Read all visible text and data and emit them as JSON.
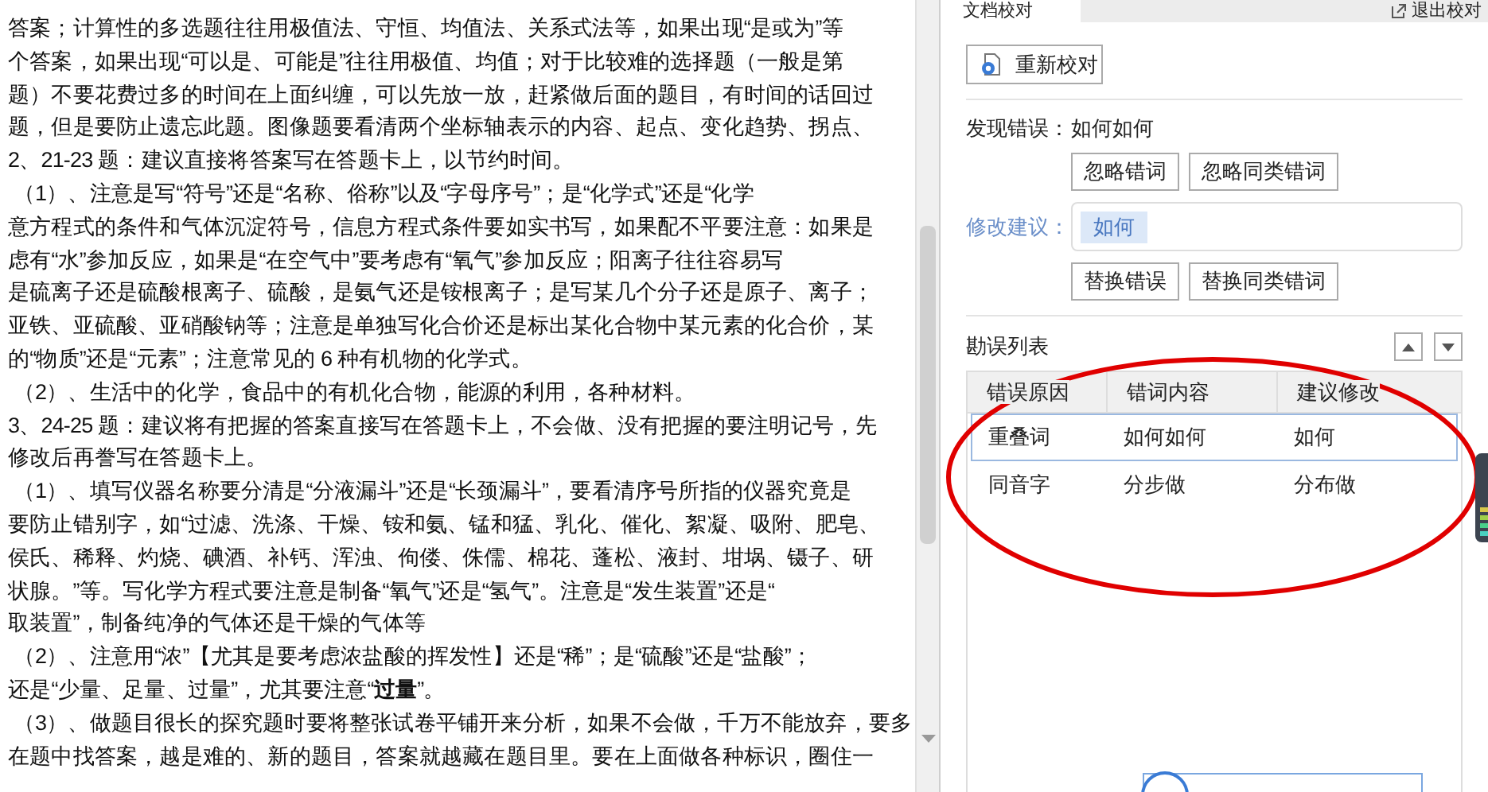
{
  "document": {
    "lines": [
      "答案；计算性的多选题往往用极值法、守恒、均值法、关系式法等，如果出现“是或为”等",
      "个答案，如果出现“可以是、可能是”往往用极值、均值；对于比较难的选择题（一般是第",
      "题）不要花费过多的时间在上面纠缠，可以先放一放，赶紧做后面的题目，有时间的话回过",
      "题，但是要防止遗忘此题。图像题要看清两个坐标轴表示的内容、起点、变化趋势、拐点、",
      "2、21-23 题：建议直接将答案写在答题卡上，以节约时间。",
      " （1）、注意是写“符号”还是“名称、俗称”以及“字母序号”；是“化学式”还是“化学",
      "意方程式的条件和气体沉淀符号，信息方程式条件要如实书写，如果配不平要注意：如果是",
      "虑有“水”参加反应，如果是“在空气中”要考虑有“氧气”参加反应；阳离子往往容易写",
      "是硫离子还是硫酸根离子、硫酸，是氨气还是铵根离子；是写某几个分子还是原子、离子；",
      "亚铁、亚硫酸、亚硝酸钠等；注意是单独写化合价还是标出某化合物中某元素的化合价，某",
      "的“物质”还是“元素”；注意常见的 6 种有机物的化学式。",
      " （2）、生活中的化学，食品中的有机化合物，能源的利用，各种材料。",
      "3、24-25 题：建议将有把握的答案直接写在答题卡上，不会做、没有把握的要注明记号，先",
      "修改后再誊写在答题卡上。",
      " （1）、填写仪器名称要分清是“分液漏斗”还是“长颈漏斗”，要看清序号所指的仪器究竟是",
      "要防止错别字，如“过滤、洗涤、干燥、铵和氨、锰和猛、乳化、催化、絮凝、吸附、肥皂、",
      "侯氏、稀释、灼烧、碘酒、补钙、浑浊、佝偻、侏儒、棉花、蓬松、液封、坩埚、镊子、研",
      "状腺。”等。写化学方程式要注意是制备“氧气”还是“氢气”。注意是“发生装置”还是“",
      "取装置”，制备纯净的气体还是干燥的气体等",
      " （2）、注意用“浓”【尤其是要考虑浓盐酸的挥发性】还是“稀”；是“硫酸”还是“盐酸”；",
      "还是“少量、足量、过量”，尤其要注意“**过量**”。",
      " （3）、做题目很长的探究题时要将整张试卷平铺开来分析，如果不会做，千万不能放弃，要多",
      "在题中找答案，越是难的、新的题目，答案就越藏在题目里。要在上面做各种标识，圈住一"
    ]
  },
  "panel": {
    "tab": "文档校对",
    "exit_button": "退出校对",
    "recheck_button": "重新校对",
    "found_label": "发现错误：",
    "found_value": "如何如何",
    "ignore_buttons": [
      "忽略错词",
      "忽略同类错词"
    ],
    "suggestion_label": "修改建议：",
    "suggestions": [
      {
        "text": "如何",
        "selected": true
      }
    ],
    "replace_buttons": [
      "替换错误",
      "替换同类错词"
    ],
    "list_title": "勘误列表",
    "table": {
      "columns": [
        "错误原因",
        "错词内容",
        "建议修改"
      ],
      "rows": [
        {
          "cells": [
            "重叠词",
            "如何如何",
            "如何"
          ],
          "selected": true
        },
        {
          "cells": [
            "同音字",
            "分步做",
            "分布做"
          ],
          "selected": false
        }
      ]
    }
  }
}
